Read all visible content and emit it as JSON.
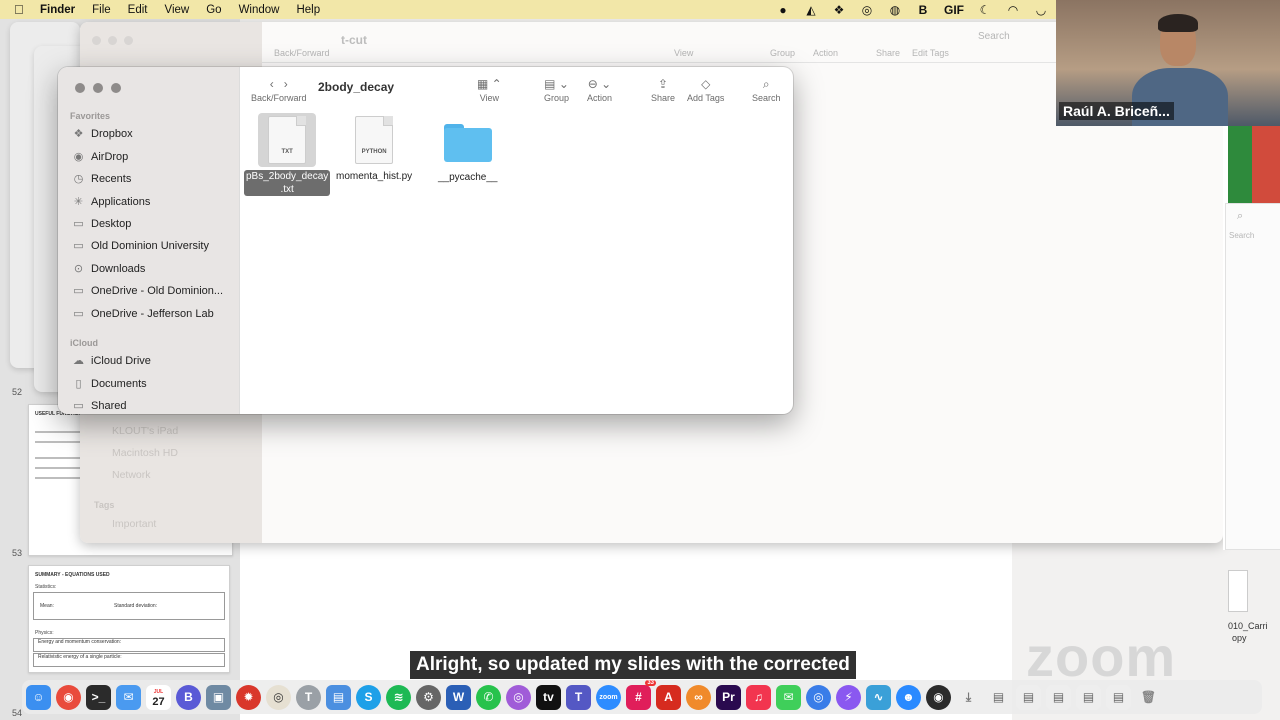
{
  "menubar": {
    "app": "Finder",
    "items": [
      "File",
      "Edit",
      "View",
      "Go",
      "Window",
      "Help"
    ],
    "status_text": "GIF"
  },
  "back_window": {
    "title": "t-cut",
    "toolbar": [
      "Back/Forward",
      "View",
      "Group",
      "Action",
      "Share",
      "Edit Tags",
      "Search"
    ],
    "sidebar_ghost": [
      "KLOUT's iPad",
      "Macintosh HD",
      "Network"
    ],
    "tags_header": "Tags",
    "tags": [
      "Important"
    ],
    "search_label": "Search",
    "shared_ghost": "Shared"
  },
  "finder": {
    "title": "2body_decay",
    "toolbar": {
      "back_forward": "Back/Forward",
      "view": "View",
      "group": "Group",
      "action": "Action",
      "share": "Share",
      "add_tags": "Add Tags",
      "search": "Search"
    },
    "sidebar": {
      "favorites_header": "Favorites",
      "favorites": [
        "Dropbox",
        "AirDrop",
        "Recents",
        "Applications",
        "Desktop",
        "Old Dominion University",
        "Downloads",
        "OneDrive - Old Dominion...",
        "OneDrive - Jefferson Lab"
      ],
      "icloud_header": "iCloud",
      "icloud": [
        "iCloud Drive",
        "Documents",
        "Shared"
      ]
    },
    "files": [
      {
        "name_line1": "pBs_2body_decay",
        "name_line2": ".txt",
        "badge": "TXT",
        "selected": true
      },
      {
        "name_line1": "momenta_hist.py",
        "badge": "PYTHON",
        "selected": false
      },
      {
        "name_line1": "__pycache__",
        "kind": "folder",
        "selected": false
      }
    ]
  },
  "slides": {
    "numbers": [
      "52",
      "53",
      "54"
    ],
    "slide53_title": "USEFUL FUNCTIONS",
    "slide54_title": "SUMMARY - EQUATIONS USED",
    "slide54_sub1": "Statistics:",
    "slide54_mean": "Mean:",
    "slide54_std": "Standard deviation:",
    "slide54_sub2": "Physics:",
    "slide54_energy": "Energy and momentum conservation:",
    "slide54_rel": "Relativistic energy of a single particle:"
  },
  "webcam": {
    "name": "Raúl A. Briceñ..."
  },
  "right_files": {
    "label1": "010_Carri",
    "label2": "opy"
  },
  "subtitle": "Alright, so updated my slides with the corrected",
  "watermark": "zoom",
  "dock": {
    "calendar_day": "27",
    "calendar_month": "JUL",
    "badge_count": "33"
  },
  "colors": {
    "menubar": "#f2e7a8",
    "folder": "#5fbff0",
    "selection": "#6d6d6d"
  }
}
